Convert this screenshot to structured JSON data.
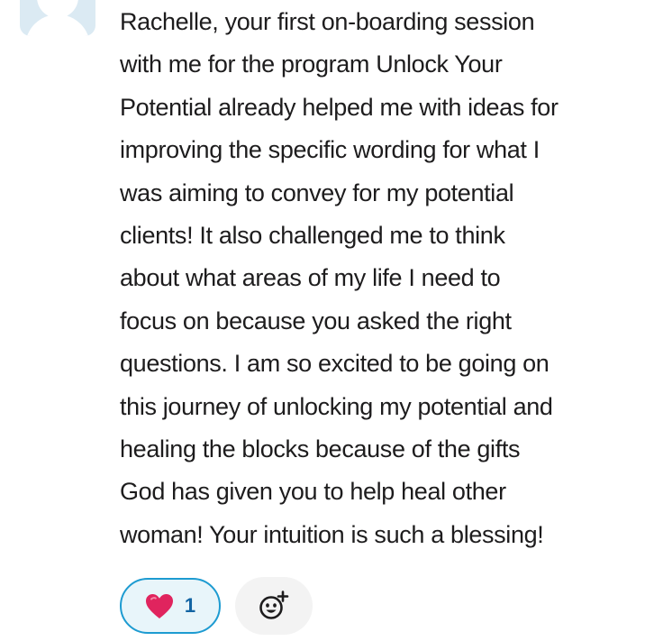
{
  "message": {
    "lines": [
      "Rachelle, your first on-boarding session",
      "with me for the program Unlock Your",
      "Potential already helped me with ideas for",
      "improving the specific wording for what I",
      "was aiming to convey for my potential",
      "clients! It also challenged me to think",
      "about what areas of my life I need to",
      "focus on because you asked the right",
      "questions. I am so excited to be going on",
      "this journey of unlocking my potential and",
      "healing the blocks because of the gifts",
      "God has given you to help heal other",
      "woman! Your intuition is such a blessing!"
    ]
  },
  "reactions": [
    {
      "emoji_icon": "red-heart-icon",
      "count": "1",
      "selected": true
    }
  ],
  "add_reaction": {
    "icon": "add-emoji-icon"
  },
  "colors": {
    "text": "#1d1c1d",
    "reaction_border": "#1d9bd1",
    "reaction_bg": "#e8f5fa",
    "reaction_count": "#1264a3",
    "heart": "#e0245e",
    "avatar_bg": "#dbeaf3",
    "add_reaction_bg": "#f3f3f3"
  }
}
